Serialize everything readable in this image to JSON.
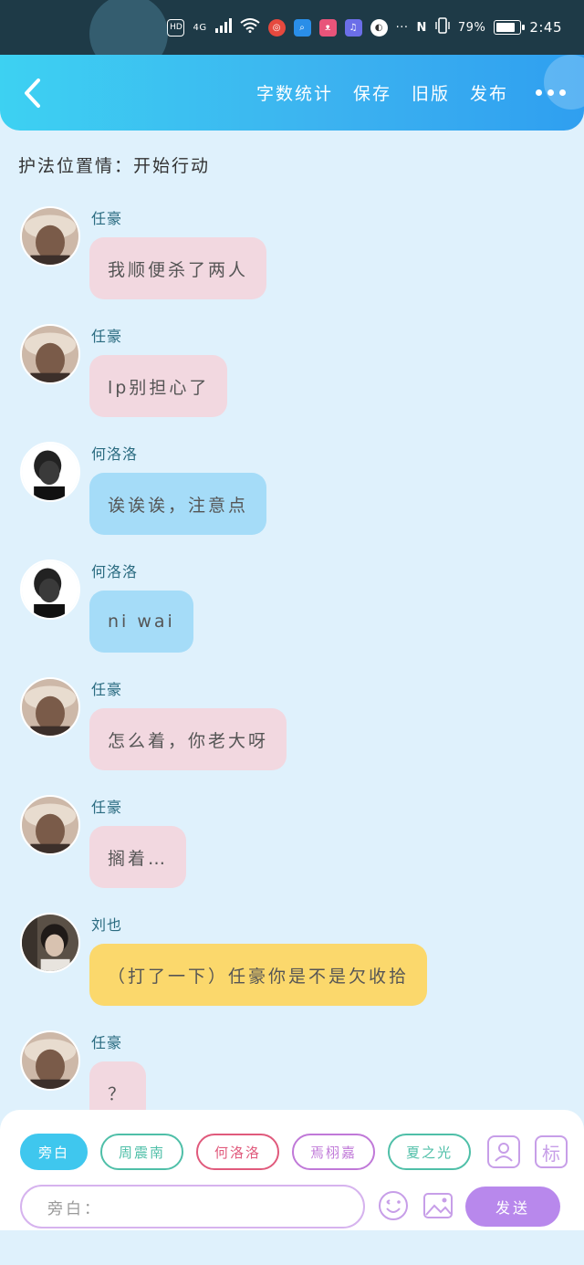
{
  "status_bar": {
    "hd": "HD",
    "network": "4G",
    "battery": "79%",
    "time": "2:45"
  },
  "header": {
    "actions": [
      "字数统计",
      "保存",
      "旧版",
      "发布"
    ]
  },
  "chat": {
    "title": "护法位置情：开始行动",
    "messages": [
      {
        "sender": "任豪",
        "text": "我顺便杀了两人",
        "style": "pink",
        "avatar": "renhao"
      },
      {
        "sender": "任豪",
        "text": "lp别担心了",
        "style": "pink",
        "avatar": "renhao"
      },
      {
        "sender": "何洛洛",
        "text": "诶诶诶，注意点",
        "style": "blue",
        "avatar": "heluoluo"
      },
      {
        "sender": "何洛洛",
        "text": "ni wai",
        "style": "blue",
        "avatar": "heluoluo"
      },
      {
        "sender": "任豪",
        "text": "怎么着，你老大呀",
        "style": "pink",
        "avatar": "renhao"
      },
      {
        "sender": "任豪",
        "text": "搁着…",
        "style": "pink",
        "avatar": "renhao"
      },
      {
        "sender": "刘也",
        "text": "（打了一下）任豪你是不是欠收拾",
        "style": "yellow",
        "avatar": "liuye"
      },
      {
        "sender": "任豪",
        "text": "？",
        "style": "pink",
        "avatar": "renhao"
      }
    ]
  },
  "composer": {
    "roles": [
      {
        "label": "旁白",
        "color": "#3fc7ee",
        "active": true
      },
      {
        "label": "周震南",
        "color": "#4fbfa8",
        "active": false
      },
      {
        "label": "何洛洛",
        "color": "#e05a7c",
        "active": false
      },
      {
        "label": "焉栩嘉",
        "color": "#c079d8",
        "active": false
      },
      {
        "label": "夏之光",
        "color": "#4fbfa8",
        "active": false
      }
    ],
    "tag_button": "标",
    "input_placeholder": "旁白：",
    "send_label": "发送"
  }
}
